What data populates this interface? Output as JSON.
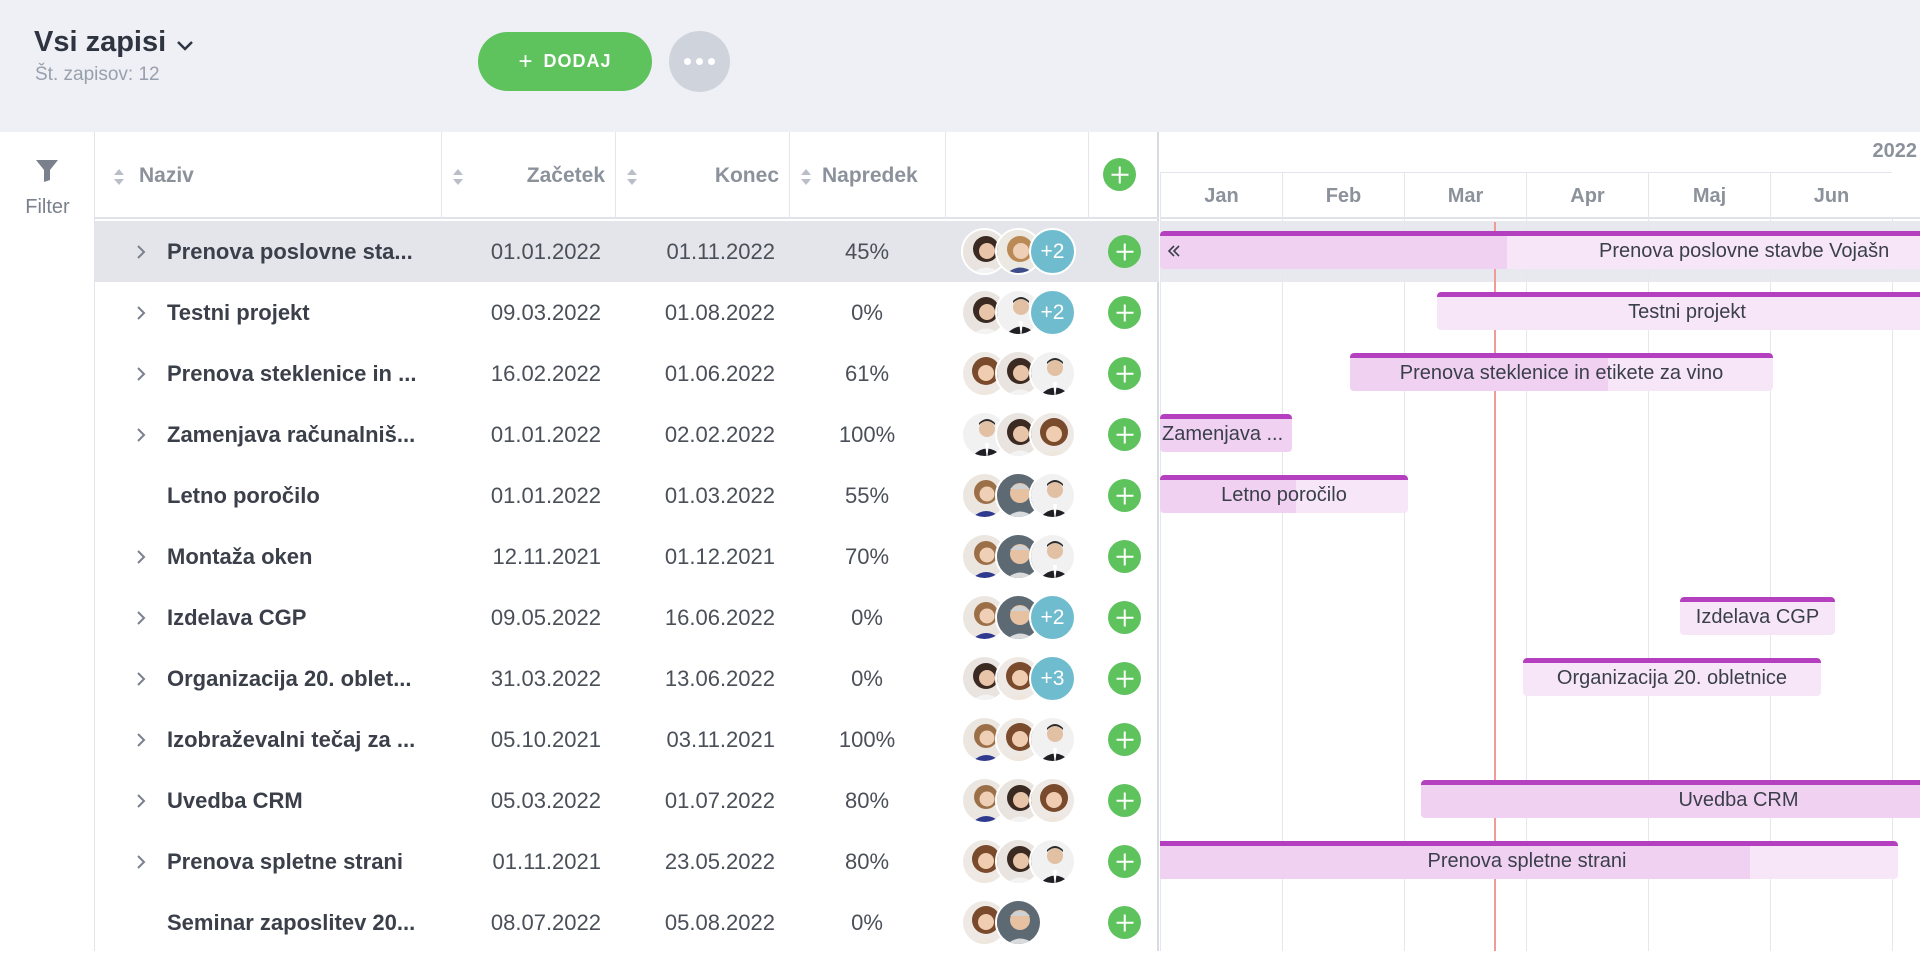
{
  "header": {
    "title": "Vsi zapisi",
    "subtitle": "Št. zapisov: 12",
    "add_label": "DODAJ",
    "add_plus": "+"
  },
  "filter": {
    "label": "Filter"
  },
  "columns": {
    "name": "Naziv",
    "start": "Začetek",
    "end": "Konec",
    "progress": "Napredek"
  },
  "rows": [
    {
      "name": "Prenova poslovne sta...",
      "start": "01.01.2022",
      "end": "01.11.2022",
      "progress": "45%",
      "expandable": true,
      "selected": true,
      "extra": "+2",
      "avatars": [
        "woman-dark-hair",
        "woman-blonde"
      ]
    },
    {
      "name": "Testni projekt",
      "start": "09.03.2022",
      "end": "01.08.2022",
      "progress": "0%",
      "expandable": true,
      "extra": "+2",
      "avatars": [
        "woman-dark-hair",
        "man-suit"
      ]
    },
    {
      "name": "Prenova steklenice in ...",
      "start": "16.02.2022",
      "end": "01.06.2022",
      "progress": "61%",
      "expandable": true,
      "avatars": [
        "woman-brown-hair",
        "woman-dark-hair",
        "man-suit"
      ]
    },
    {
      "name": "Zamenjava računalniš...",
      "start": "01.01.2022",
      "end": "02.02.2022",
      "progress": "100%",
      "expandable": true,
      "avatars": [
        "man-suit",
        "woman-dark-hair",
        "woman-brown-hair"
      ]
    },
    {
      "name": "Letno poročilo",
      "start": "01.01.2022",
      "end": "01.03.2022",
      "progress": "55%",
      "expandable": false,
      "avatars": [
        "woman-blue",
        "man-grey",
        "man-suit"
      ]
    },
    {
      "name": "Montaža oken",
      "start": "12.11.2021",
      "end": "01.12.2021",
      "progress": "70%",
      "expandable": true,
      "avatars": [
        "woman-blue",
        "man-grey",
        "man-suit"
      ]
    },
    {
      "name": "Izdelava CGP",
      "start": "09.05.2022",
      "end": "16.06.2022",
      "progress": "0%",
      "expandable": true,
      "extra": "+2",
      "avatars": [
        "woman-blue",
        "man-grey"
      ]
    },
    {
      "name": "Organizacija 20. oblet...",
      "start": "31.03.2022",
      "end": "13.06.2022",
      "progress": "0%",
      "expandable": true,
      "extra": "+3",
      "avatars": [
        "woman-dark-hair",
        "woman-brown-hair"
      ]
    },
    {
      "name": "Izobraževalni tečaj za ...",
      "start": "05.10.2021",
      "end": "03.11.2021",
      "progress": "100%",
      "expandable": true,
      "avatars": [
        "woman-blue",
        "woman-brown-hair",
        "man-suit"
      ]
    },
    {
      "name": "Uvedba CRM",
      "start": "05.03.2022",
      "end": "01.07.2022",
      "progress": "80%",
      "expandable": true,
      "avatars": [
        "woman-blue",
        "woman-dark-hair",
        "woman-brown-hair"
      ]
    },
    {
      "name": "Prenova spletne strani",
      "start": "01.11.2021",
      "end": "23.05.2022",
      "progress": "80%",
      "expandable": true,
      "avatars": [
        "woman-brown-hair",
        "woman-dark-hair",
        "man-suit"
      ]
    },
    {
      "name": "Seminar zaposlitev 20...",
      "start": "08.07.2022",
      "end": "05.08.2022",
      "progress": "0%",
      "expandable": false,
      "avatars": [
        "woman-brown-hair",
        "man-grey"
      ]
    }
  ],
  "gantt": {
    "year": "2022",
    "months": [
      "Jan",
      "Feb",
      "Mar",
      "Apr",
      "Maj",
      "Jun"
    ],
    "bars": [
      {
        "row": 0,
        "label": "Prenova poslovne stavbe Vojašn",
        "progress": 0.45,
        "has_back_arrow": true
      },
      {
        "row": 1,
        "label": "Testni projekt",
        "progress": 0
      },
      {
        "row": 2,
        "label": "Prenova steklenice in etikete za vino",
        "progress": 0.61
      },
      {
        "row": 3,
        "label": "Zamenjava ...",
        "progress": 1.0
      },
      {
        "row": 4,
        "label": "Letno poročilo",
        "progress": 0.55
      },
      {
        "row": 6,
        "label": "Izdelava CGP",
        "progress": 0
      },
      {
        "row": 7,
        "label": "Organizacija 20. obletnice",
        "progress": 0
      },
      {
        "row": 9,
        "label": "Uvedba CRM",
        "progress": 0.8
      },
      {
        "row": 10,
        "label": "Prenova spletne strani",
        "progress": 0.8
      }
    ]
  },
  "colors": {
    "accent_green": "#5ec25d",
    "bar_top": "#b440c0",
    "bar_fill": "#f0d1f2",
    "bar_bg": "#f7e6f8",
    "today_line": "#f09a9a",
    "extra_badge": "#6fbccf"
  }
}
